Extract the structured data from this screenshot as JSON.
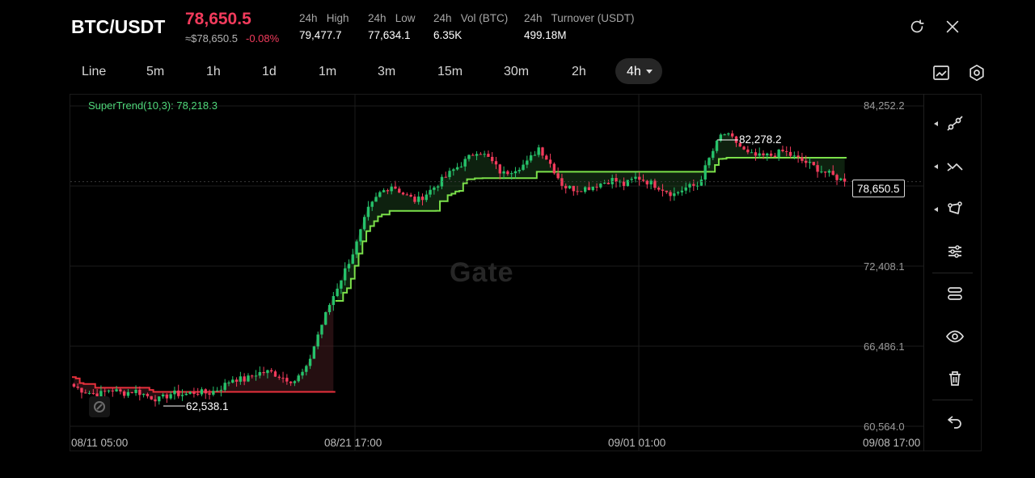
{
  "header": {
    "pair": "BTC/USDT",
    "last_price": "78,650.5",
    "fiat_price": "≈$78,650.5",
    "change": "-0.08%",
    "stats": [
      {
        "label": "24h   High",
        "value": "79,477.7"
      },
      {
        "label": "24h   Low",
        "value": "77,634.1"
      },
      {
        "label": "24h   Vol (BTC)",
        "value": "6.35K"
      },
      {
        "label": "24h   Turnover (USDT)",
        "value": "499.18M"
      }
    ],
    "icons": [
      "refresh-icon",
      "close-icon"
    ]
  },
  "timeframes": {
    "items": [
      "Line",
      "5m",
      "1h",
      "1d",
      "1m",
      "3m",
      "15m",
      "30m",
      "2h"
    ],
    "active": "4h",
    "tools": [
      "chart-style-icon",
      "settings-icon"
    ]
  },
  "chart": {
    "indicator": "SuperTrend(10,3): 78,218.3",
    "y_ticks": [
      "84,252.2",
      "72,408.1",
      "66,486.1",
      "60,564.0"
    ],
    "x_ticks": [
      "08/11 05:00",
      "08/21 17:00",
      "09/01 01:00",
      "09/08 17:00"
    ],
    "current_price_tag": "78,650.5",
    "high_marker": "82,278.2",
    "low_marker": "62,538.1",
    "watermark": "Gate",
    "colors": {
      "up": "#26c26b",
      "down": "#f23b5c",
      "supertrend_up": "#7be04a",
      "supertrend_down": "#e8303c"
    }
  },
  "chart_data": {
    "type": "candlestick",
    "symbol": "BTC/USDT",
    "interval": "4h",
    "ylim": [
      60564.0,
      84252.2
    ],
    "x_ticks": [
      "08/11 05:00",
      "08/21 17:00",
      "09/01 01:00",
      "09/08 17:00"
    ],
    "y_ticks": [
      "84,252.2",
      "72,408.1",
      "66,486.1",
      "60,564.0"
    ],
    "anchors": [
      63500,
      63100,
      62900,
      63300,
      63000,
      63200,
      62800,
      62538.1,
      63000,
      62900,
      63100,
      63000,
      63400,
      64100,
      64000,
      64500,
      64600,
      64200,
      63900,
      64800,
      67500,
      69800,
      71800,
      73800,
      76500,
      77800,
      78400,
      77700,
      77200,
      77900,
      78700,
      79500,
      80200,
      81000,
      80300,
      79200,
      79600,
      80000,
      81200,
      79900,
      78300,
      78100,
      78200,
      78500,
      78800,
      78400,
      79000,
      78600,
      78200,
      77700,
      78200,
      78400,
      80500,
      82278.2,
      81700,
      80700,
      80500,
      80600,
      80900,
      80400,
      80000,
      79500,
      79100,
      78650.5
    ],
    "supertrend": {
      "name": "SuperTrend(10,3)",
      "last_value": 78218.3
    },
    "high": 82278.2,
    "low": 62538.1,
    "last": 78650.5
  },
  "sidebar": {
    "tools": [
      "line-tool-icon",
      "trend-tool-icon",
      "shape-tool-icon",
      "indicator-settings-icon",
      "layers-icon",
      "visibility-icon",
      "delete-icon",
      "undo-icon"
    ]
  }
}
